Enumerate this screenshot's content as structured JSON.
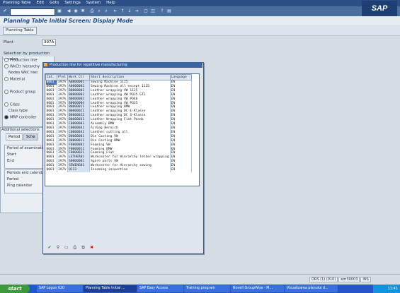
{
  "menubar": {
    "items": [
      "Planning Table",
      "Edit",
      "Goto",
      "Settings",
      "System",
      "Help"
    ]
  },
  "header": {
    "title": "Planning Table Initial Screen: Display Mode",
    "toolbar_button": "Planning Table"
  },
  "plant": {
    "label": "Plant",
    "value": "397A"
  },
  "selection": {
    "header": "Selection by production version",
    "options": [
      "Production line",
      "WkCtr hierarchy",
      "Nodes WkC hier.",
      "Material",
      "Product group",
      "Class",
      "Class type",
      "MRP controller"
    ],
    "selected": "MRP controller"
  },
  "additional": {
    "header": "Additional selections",
    "tabs": [
      "Period",
      "Sche"
    ],
    "period_group": {
      "title": "Period of examinati",
      "start": "Start",
      "end": "End"
    },
    "calendar_group": {
      "title": "Periods and calenda",
      "period": "Period",
      "calendar": "Plng calendar"
    }
  },
  "popup": {
    "title": "Production line for repetitive manufacturing",
    "columns": [
      "Cat.",
      "Plnt",
      "Work Ctr",
      "Short description",
      "Language"
    ],
    "rows": [
      [
        "0001",
        "397A",
        "A0000001",
        "Sewing Machine 1125",
        "EN"
      ],
      [
        "0001",
        "397A",
        "A0000002",
        "Sewing Machine all except 1125",
        "EN"
      ],
      [
        "0001",
        "397A",
        "B0000001",
        "Leather wrapping  VW 1125",
        "EN"
      ],
      [
        "0001",
        "397A",
        "B0000002",
        "Leather wrapping  VW PQ35 GTI",
        "EN"
      ],
      [
        "0001",
        "397A",
        "B0000003",
        "Leather wrapping  VW PQ46",
        "EN"
      ],
      [
        "0001",
        "397A",
        "B0000004",
        "Leather wrapping  VW PQ35",
        "EN"
      ],
      [
        "0001",
        "397A",
        "B0000011",
        "Leather wrapping  BMW",
        "EN"
      ],
      [
        "0001",
        "397A",
        "B0000021",
        "Leather wrapping  DC E-Klasse",
        "EN"
      ],
      [
        "0001",
        "397A",
        "B0000022",
        "Leather wrapping  DC S-Klasse",
        "EN"
      ],
      [
        "0001",
        "397A",
        "B0000031",
        "Leather Wrapping Fiat Panda",
        "EN"
      ],
      [
        "0001",
        "397A",
        "C0000001",
        "Assembly BMW",
        "EN"
      ],
      [
        "0001",
        "397A",
        "C0000041",
        "Airbag Bereich",
        "EN"
      ],
      [
        "0001",
        "397A",
        "C0000041",
        "Leather cutting all",
        "EN"
      ],
      [
        "0001",
        "397A",
        "D0000001",
        "Die Casting VW",
        "EN"
      ],
      [
        "0001",
        "397A",
        "D0000011",
        "Die Casting BMW",
        "EN"
      ],
      [
        "0001",
        "397A",
        "F0000001",
        "Foaming VW",
        "EN"
      ],
      [
        "0001",
        "397A",
        "F0000011",
        "Foaming BMW",
        "EN"
      ],
      [
        "0001",
        "397A",
        "F0000031",
        "Foaming Fiat",
        "EN"
      ],
      [
        "0001",
        "397A",
        "LETHER01",
        "Workcenter for Hierarchy lether wrapping",
        "EN"
      ],
      [
        "0001",
        "397A",
        "S0000001",
        "Spare parts VW",
        "EN"
      ],
      [
        "0001",
        "397A",
        "SEWING01",
        "Workcenter for Hierarchy sewing",
        "EN"
      ],
      [
        "0001",
        "397A",
        "QC13",
        "Incoming inspection",
        "EN"
      ]
    ],
    "buttons": [
      "check-icon",
      "filter-icon",
      "new-icon",
      "print-icon",
      "copy-icon",
      "cancel-icon"
    ]
  },
  "status": {
    "session": "ORS (1) (010)",
    "server": "eor30003",
    "mode": "INS"
  },
  "taskbar": {
    "start": "start",
    "tasks": [
      "SAP Logon 620",
      "Planning Table Initial ...",
      "SAP Easy Access",
      "Training program",
      "Novell GroupWise - M...",
      "Vizualizarea planului d..."
    ],
    "clock": "11:41"
  },
  "colors": {
    "menubar": "#2b4f86",
    "title": "#1e4c8a",
    "popup_header": "#3c64a0",
    "taskbar": "#2456c8",
    "start": "#3c9a3c"
  }
}
